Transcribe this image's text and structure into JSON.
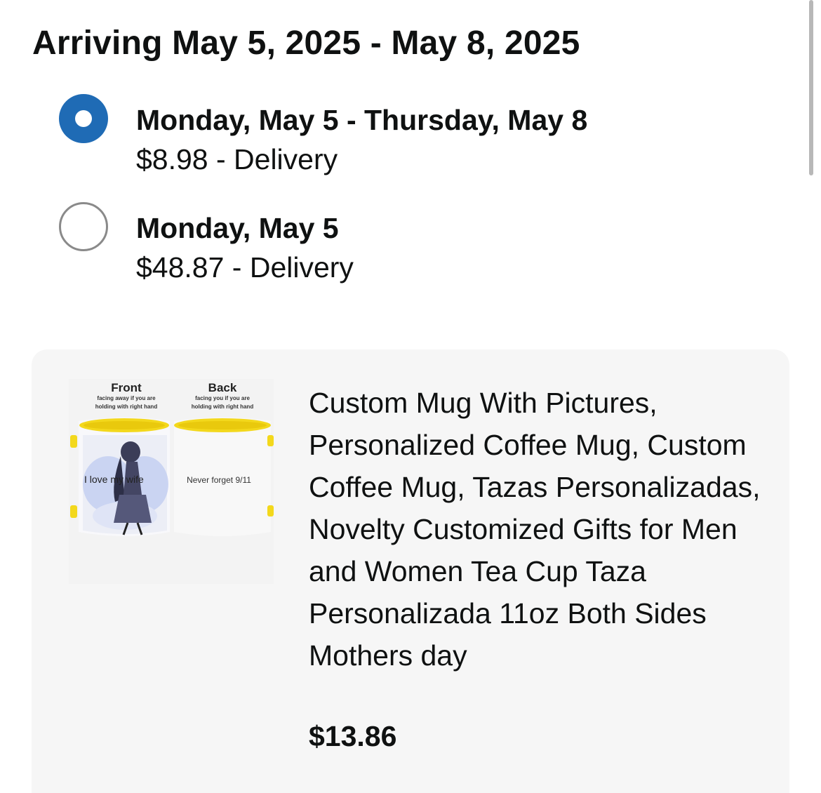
{
  "header": {
    "title": "Arriving May 5, 2025 - May 8, 2025"
  },
  "delivery_options": [
    {
      "date": "Monday, May 5 - Thursday, May 8",
      "price_label": "$8.98 - Delivery",
      "selected": true
    },
    {
      "date": "Monday, May 5",
      "price_label": "$48.87 - Delivery",
      "selected": false
    }
  ],
  "product": {
    "title": "Custom Mug With Pictures, Personalized Coffee Mug, Custom Coffee Mug, Tazas Personalizadas, Novelty Customized Gifts for Men and Women Tea Cup Taza Personalizada 11oz Both Sides Mothers day",
    "price": "$13.86",
    "image": {
      "front_label": "Front",
      "front_caption_1": "facing away if you are",
      "front_caption_2": "holding with right hand",
      "back_label": "Back",
      "back_caption_1": "facing you if you are",
      "back_caption_2": "holding with right hand",
      "front_text": "I love my wife",
      "back_text": "Never forget 9/11",
      "mug_accent_color": "#f3d81c"
    }
  },
  "colors": {
    "radio_selected": "#1f6bb5",
    "card_background": "#f6f6f6"
  }
}
